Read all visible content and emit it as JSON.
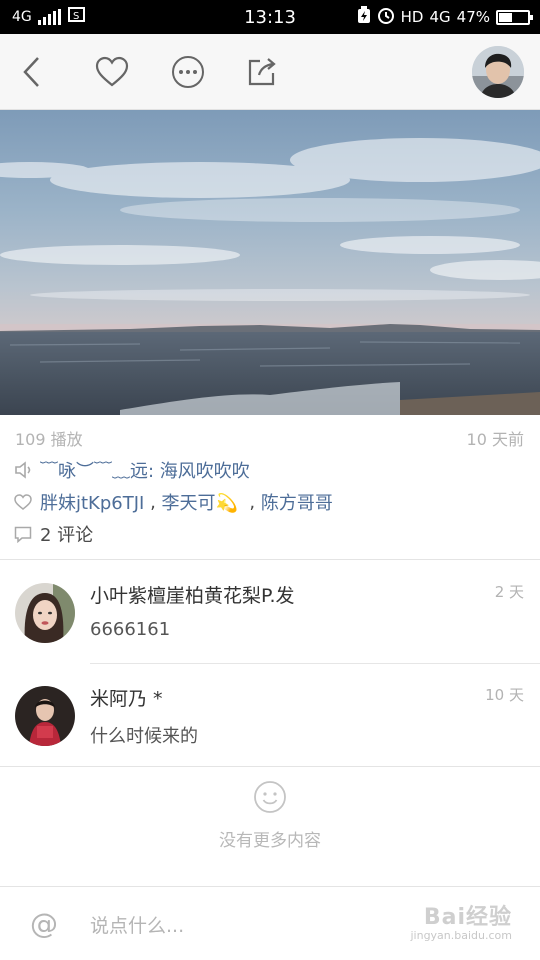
{
  "status_bar": {
    "network": "4G",
    "time": "13:13",
    "hd": "HD",
    "net2": "4G",
    "battery": "47%",
    "battery_level": 0.47
  },
  "nav": {
    "back_icon": "chevron-left-icon",
    "like_icon": "heart-icon",
    "more_icon": "more-icon",
    "share_icon": "share-icon"
  },
  "post": {
    "plays": "109 播放",
    "time_ago": "10 天前",
    "audio_title": "﹋咏︶﹋﹏远: 海风吹吹吹",
    "likes": [
      "胖妹jtKp6TJI",
      "李天可💫",
      "陈方哥哥"
    ],
    "likes_sep1": " , ",
    "likes_sep2": "  , ",
    "comment_count": "2 评论"
  },
  "comments": [
    {
      "name": "小叶紫檀崖柏黄花梨P.发",
      "text": "6666161",
      "time": "2 天"
    },
    {
      "name": "米阿乃 *",
      "text": "什么时候来的",
      "time": "10 天"
    }
  ],
  "empty_state": {
    "icon": "smiley-icon",
    "text": "没有更多内容"
  },
  "input": {
    "at_symbol": "@",
    "placeholder": "说点什么..."
  },
  "watermark": {
    "main": "Bai经验",
    "sub": "jingyan.baidu.com"
  },
  "colors": {
    "link": "#4d6d98",
    "muted": "#b3b3b3",
    "nav_bg": "#f7f7f7"
  }
}
